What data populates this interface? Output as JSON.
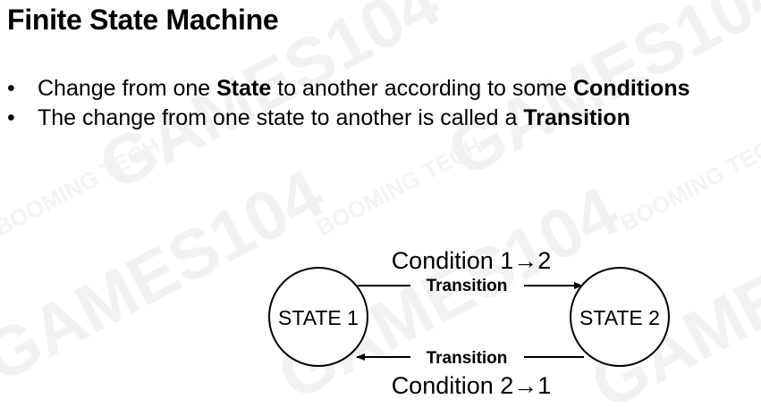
{
  "slide": {
    "title": "Finite State Machine"
  },
  "bullets": [
    {
      "parts": [
        {
          "text": "Change from one ",
          "bold": false
        },
        {
          "text": "State",
          "bold": true
        },
        {
          "text": " to another according to some ",
          "bold": false
        },
        {
          "text": "Conditions",
          "bold": true
        }
      ]
    },
    {
      "parts": [
        {
          "text": "The change from one state to another is called a ",
          "bold": false
        },
        {
          "text": "Transition",
          "bold": true
        }
      ]
    }
  ],
  "diagram": {
    "states": [
      {
        "id": "state1",
        "label": "STATE 1"
      },
      {
        "id": "state2",
        "label": "STATE 2"
      }
    ],
    "transitions": [
      {
        "from": "state1",
        "to": "state2",
        "label": "Transition",
        "condition": "Condition 1→2"
      },
      {
        "from": "state2",
        "to": "state1",
        "label": "Transition",
        "condition": "Condition 2→1"
      }
    ]
  },
  "watermark": {
    "texts": [
      "GAMES104",
      "BOOMING TECH"
    ],
    "color": "#f3f3f3"
  }
}
